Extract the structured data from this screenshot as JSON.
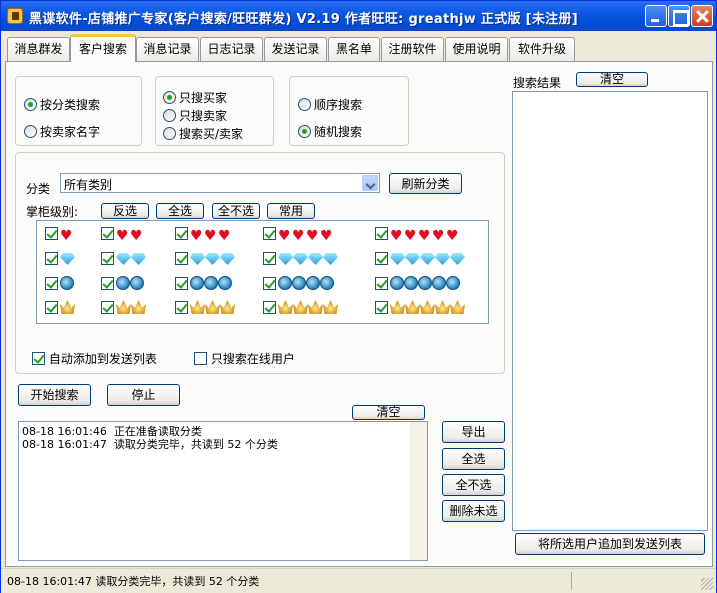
{
  "window": {
    "title": "黑谍软件-店铺推广专家(客户搜索/旺旺群发) V2.19 作者旺旺: greathjw 正式版 [未注册]"
  },
  "tabs": [
    {
      "label": "消息群发"
    },
    {
      "label": "客户搜索",
      "active": true
    },
    {
      "label": "消息记录"
    },
    {
      "label": "日志记录"
    },
    {
      "label": "发送记录"
    },
    {
      "label": "黑名单"
    },
    {
      "label": "注册软件"
    },
    {
      "label": "使用说明"
    },
    {
      "label": "软件升级"
    }
  ],
  "search_mode": {
    "by_category": "按分类搜索",
    "by_seller": "按卖家名字",
    "selected": "by_category"
  },
  "target": {
    "buyers_only": "只搜买家",
    "sellers_only": "只搜卖家",
    "both": "搜索买/卖家",
    "selected": "buyers_only"
  },
  "order": {
    "sequential": "顺序搜索",
    "random": "随机搜索",
    "selected": "random"
  },
  "category": {
    "label": "分类",
    "value": "所有类别",
    "refresh_button": "刷新分类"
  },
  "level": {
    "label": "掌柜级别:",
    "invert_button": "反选",
    "select_all_button": "全选",
    "select_none_button": "全不选",
    "common_button": "常用"
  },
  "level_rows": [
    {
      "icon": "heart-icon",
      "counts": [
        1,
        2,
        3,
        4,
        5
      ]
    },
    {
      "icon": "diamond-icon",
      "counts": [
        1,
        2,
        3,
        4,
        5
      ]
    },
    {
      "icon": "blue-crown-icon",
      "counts": [
        1,
        2,
        3,
        4,
        5
      ]
    },
    {
      "icon": "gold-crown-icon",
      "counts": [
        1,
        2,
        3,
        4,
        5
      ]
    }
  ],
  "options": {
    "auto_add": "自动添加到发送列表",
    "auto_add_checked": true,
    "online_only": "只搜索在线用户",
    "online_only_checked": false
  },
  "actions": {
    "start": "开始搜索",
    "stop": "停止",
    "clear_log": "清空"
  },
  "log_lines": [
    "08-18 16:01:46  正在准备读取分类",
    "08-18 16:01:47  读取分类完毕，共读到 52 个分类"
  ],
  "side_buttons": {
    "export": "导出",
    "select_all": "全选",
    "select_none": "全不选",
    "delete_unselected": "删除未选"
  },
  "results": {
    "label": "搜索结果",
    "clear_button": "清空",
    "add_to_send": "将所选用户追加到发送列表"
  },
  "status": {
    "text": "08-18 16:01:47   读取分类完毕，共读到 52 个分类"
  }
}
